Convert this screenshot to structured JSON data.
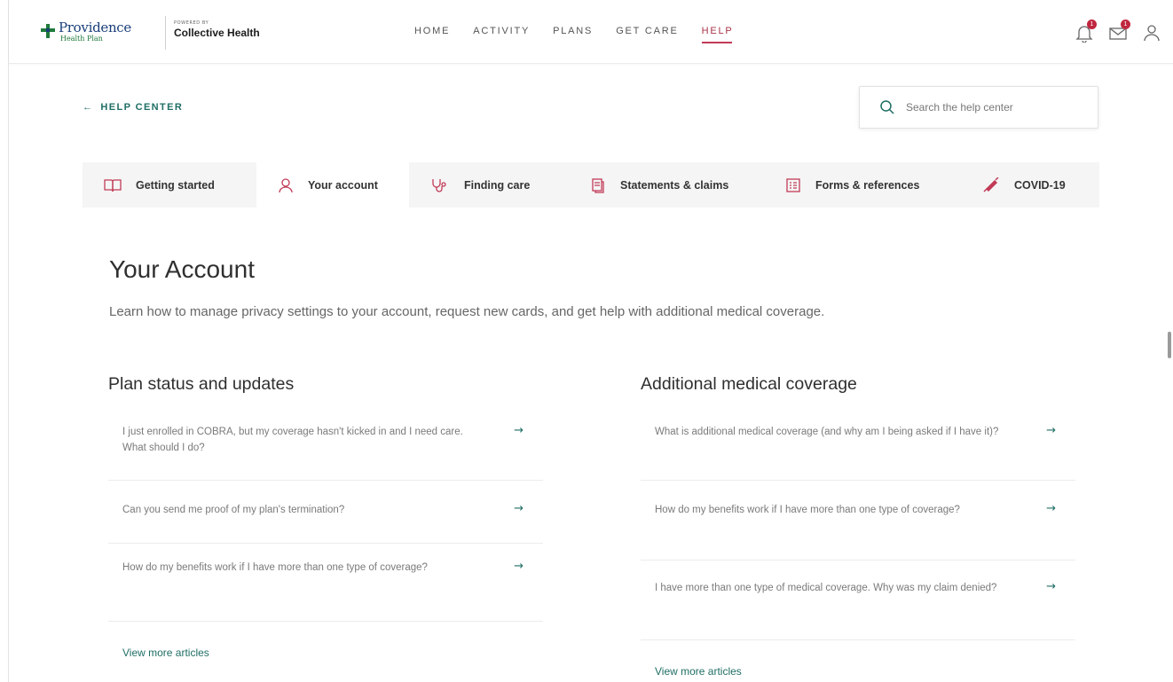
{
  "brand": {
    "name": "Providence",
    "sub": "Health Plan",
    "powered_label": "POWERED BY",
    "partner": "Collective Health"
  },
  "nav": {
    "links": [
      "HOME",
      "ACTIVITY",
      "PLANS",
      "GET CARE",
      "HELP"
    ],
    "active": "HELP",
    "notifications_badge": "1",
    "messages_badge": "1"
  },
  "help": {
    "back_label": "HELP CENTER",
    "search_placeholder": "Search the help center"
  },
  "tabs": [
    {
      "label": "Getting started",
      "icon": "book-icon"
    },
    {
      "label": "Your account",
      "icon": "person-icon"
    },
    {
      "label": "Finding care",
      "icon": "stethoscope-icon"
    },
    {
      "label": "Statements & claims",
      "icon": "documents-icon"
    },
    {
      "label": "Forms & references",
      "icon": "form-icon"
    },
    {
      "label": "COVID-19",
      "icon": "syringe-icon"
    }
  ],
  "active_tab": "Your account",
  "page": {
    "title": "Your Account",
    "description": "Learn how to manage privacy settings to your account, request new cards, and get help with additional medical coverage."
  },
  "sections": [
    {
      "title": "Plan status and updates",
      "articles": [
        "I just enrolled in COBRA, but my coverage hasn't kicked in and I need care. What should I do?",
        "Can you send me proof of my plan's termination?",
        "How do my benefits work if I have more than one type of coverage?"
      ],
      "more": "View more articles"
    },
    {
      "title": "Additional medical coverage",
      "articles": [
        "What is additional medical coverage (and why am I being asked if I have it)?",
        "How do my benefits work if I have more than one type of coverage?",
        "I have more than one type of medical coverage. Why was my claim denied?"
      ],
      "more": "View more articles"
    }
  ],
  "colors": {
    "accent": "#1f6e64",
    "active_nav": "#c13b57",
    "badge": "#c0273f"
  }
}
